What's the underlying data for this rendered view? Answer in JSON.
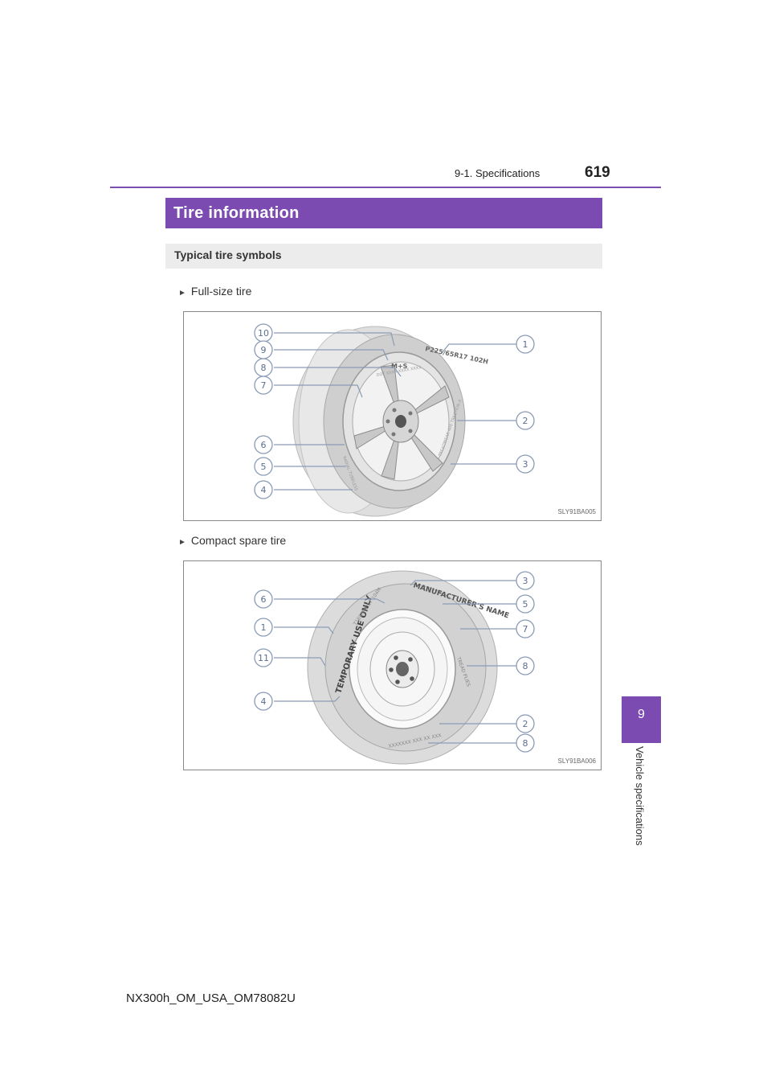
{
  "header": {
    "section": "9-1. Specifications",
    "page_number": "619"
  },
  "title": "Tire information",
  "subtitle": "Typical tire symbols",
  "bullets": {
    "full_size": "Full-size tire",
    "compact_spare": "Compact spare tire"
  },
  "figures": {
    "full_size_code": "SLY91BA005",
    "compact_code": "SLY91BA006",
    "full_size_callouts_left": [
      "10",
      "9",
      "8",
      "7",
      "6",
      "5",
      "4"
    ],
    "full_size_callouts_right": [
      "1",
      "2",
      "3"
    ],
    "compact_callouts_left": [
      "6",
      "1",
      "11",
      "4"
    ],
    "compact_callouts_right": [
      "3",
      "5",
      "7",
      "8",
      "2",
      "8"
    ],
    "sidewall_text_full": {
      "size": "P225/65R17 102H",
      "ms": "M+S"
    },
    "sidewall_text_compact": {
      "temp": "TEMPORARY USE ONLY",
      "manufacturer": "MANUFACTURER'S NAME"
    }
  },
  "side_tab": {
    "number": "9",
    "label": "Vehicle specifications"
  },
  "footer": "NX300h_OM_USA_OM78082U",
  "colors": {
    "accent": "#7c4bb2",
    "callout": "#8a9bb5"
  }
}
